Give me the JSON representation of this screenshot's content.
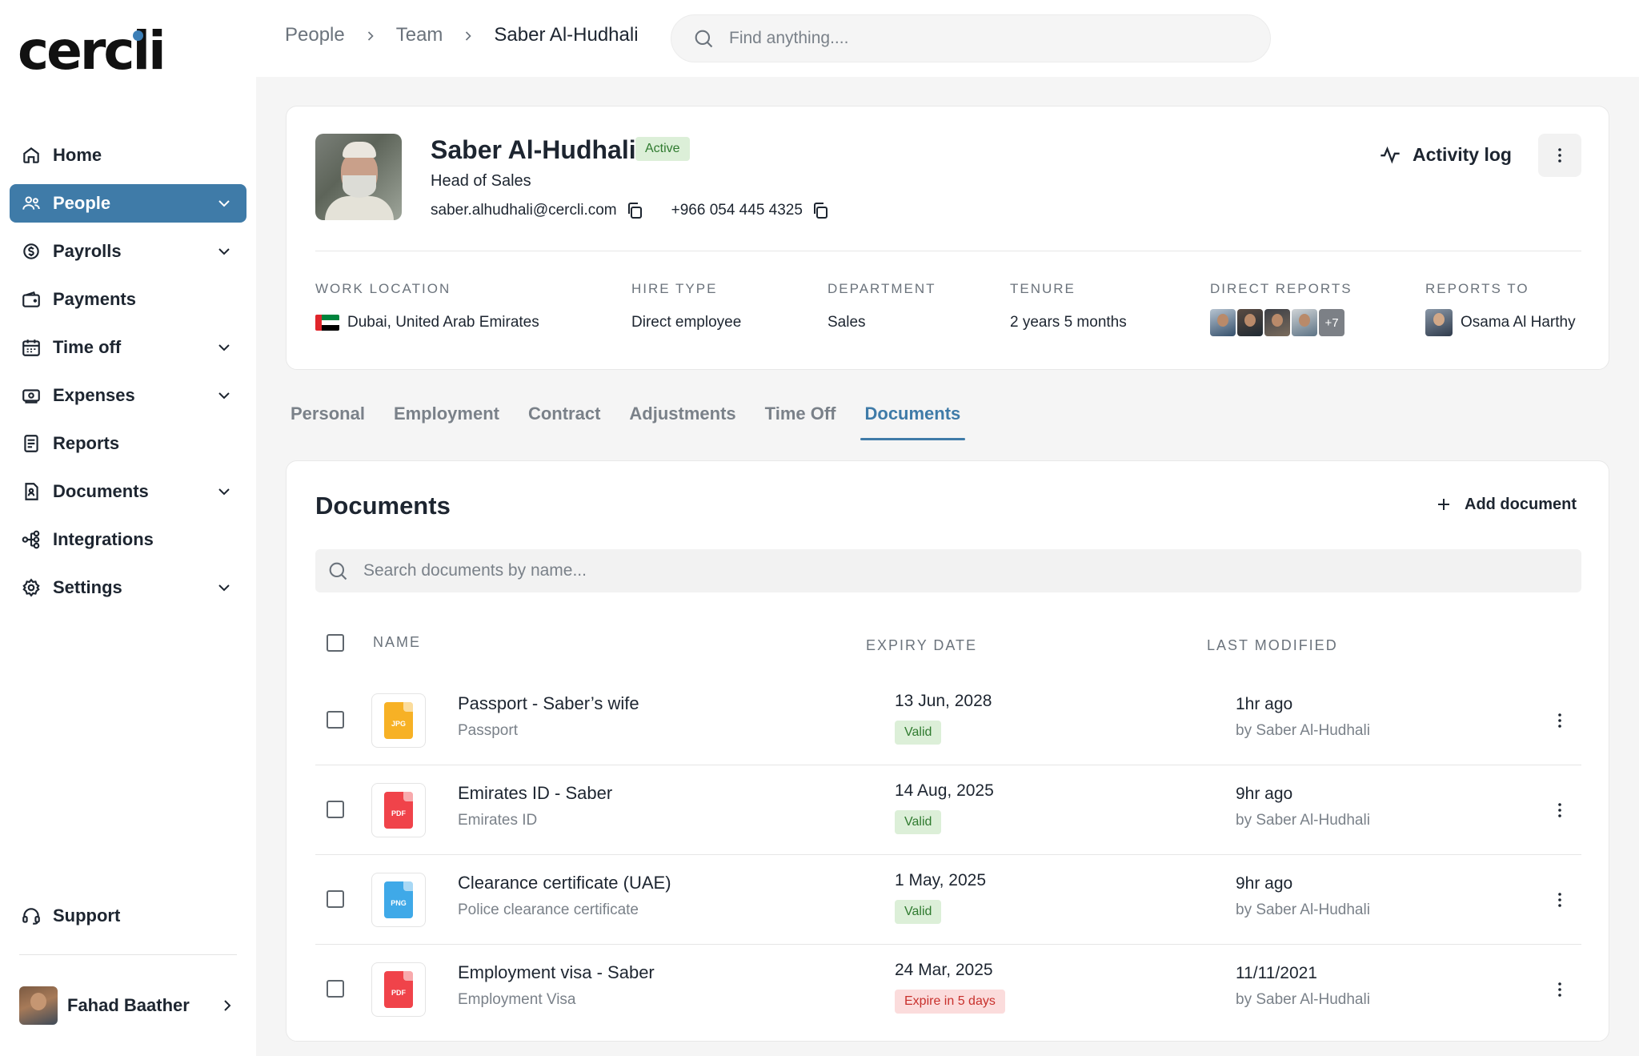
{
  "brand": {
    "logo_text": "cercli",
    "accent": "#3f7ba8"
  },
  "sidebar": {
    "items": [
      {
        "label": "Home",
        "icon": "home-icon",
        "active": false,
        "expandable": false
      },
      {
        "label": "People",
        "icon": "people-icon",
        "active": true,
        "expandable": true
      },
      {
        "label": "Payrolls",
        "icon": "payrolls-icon",
        "active": false,
        "expandable": true
      },
      {
        "label": "Payments",
        "icon": "wallet-icon",
        "active": false,
        "expandable": false
      },
      {
        "label": "Time off",
        "icon": "calendar-icon",
        "active": false,
        "expandable": true
      },
      {
        "label": "Expenses",
        "icon": "expenses-icon",
        "active": false,
        "expandable": true
      },
      {
        "label": "Reports",
        "icon": "reports-icon",
        "active": false,
        "expandable": false
      },
      {
        "label": "Documents",
        "icon": "documents-icon",
        "active": false,
        "expandable": true
      },
      {
        "label": "Integrations",
        "icon": "integrations-icon",
        "active": false,
        "expandable": false
      },
      {
        "label": "Settings",
        "icon": "gear-icon",
        "active": false,
        "expandable": true
      }
    ],
    "support_label": "Support",
    "user_name": "Fahad Baather"
  },
  "header": {
    "breadcrumb": [
      "People",
      "Team",
      "Saber Al-Hudhali"
    ],
    "search_placeholder": "Find anything...."
  },
  "profile": {
    "name": "Saber Al-Hudhali",
    "status": "Active",
    "role": "Head of Sales",
    "email": "saber.alhudhali@cercli.com",
    "phone": "+966 054 445 4325",
    "activity_label": "Activity log",
    "meta": {
      "work_location_label": "WORK LOCATION",
      "work_location": "Dubai, United Arab Emirates",
      "hire_type_label": "HIRE TYPE",
      "hire_type": "Direct employee",
      "department_label": "DEPARTMENT",
      "department": "Sales",
      "tenure_label": "TENURE",
      "tenure": "2 years 5 months",
      "direct_reports_label": "DIRECT REPORTS",
      "direct_reports_more": "+7",
      "reports_to_label": "REPORTS TO",
      "reports_to": "Osama Al Harthy"
    }
  },
  "tabs": [
    {
      "label": "Personal",
      "active": false
    },
    {
      "label": "Employment",
      "active": false
    },
    {
      "label": "Contract",
      "active": false
    },
    {
      "label": "Adjustments",
      "active": false
    },
    {
      "label": "Time Off",
      "active": false
    },
    {
      "label": "Documents",
      "active": true
    }
  ],
  "documents": {
    "title": "Documents",
    "add_label": "Add document",
    "search_placeholder": "Search documents by name...",
    "columns": {
      "name": "NAME",
      "expiry": "EXPIRY DATE",
      "modified": "LAST MODIFIED"
    },
    "rows": [
      {
        "name": "Passport - Saber’s wife",
        "type": "Passport",
        "file": "JPG",
        "file_color": "#f7b125",
        "expiry": "13 Jun, 2028",
        "status": "Valid",
        "status_kind": "valid",
        "modified": "1hr ago",
        "modified_by": "by Saber Al-Hudhali"
      },
      {
        "name": "Emirates ID - Saber",
        "type": "Emirates ID",
        "file": "PDF",
        "file_color": "#f0434a",
        "expiry": "14 Aug, 2025",
        "status": "Valid",
        "status_kind": "valid",
        "modified": "9hr ago",
        "modified_by": "by Saber Al-Hudhali"
      },
      {
        "name": "Clearance certificate (UAE)",
        "type": "Police clearance certificate",
        "file": "PNG",
        "file_color": "#3fa9e8",
        "expiry": "1 May, 2025",
        "status": "Valid",
        "status_kind": "valid",
        "modified": "9hr ago",
        "modified_by": "by Saber Al-Hudhali"
      },
      {
        "name": "Employment visa - Saber",
        "type": "Employment Visa",
        "file": "PDF",
        "file_color": "#f0434a",
        "expiry": "24 Mar, 2025",
        "status": "Expire in 5 days",
        "status_kind": "warn",
        "modified": "11/11/2021",
        "modified_by": "by Saber Al-Hudhali"
      }
    ]
  }
}
